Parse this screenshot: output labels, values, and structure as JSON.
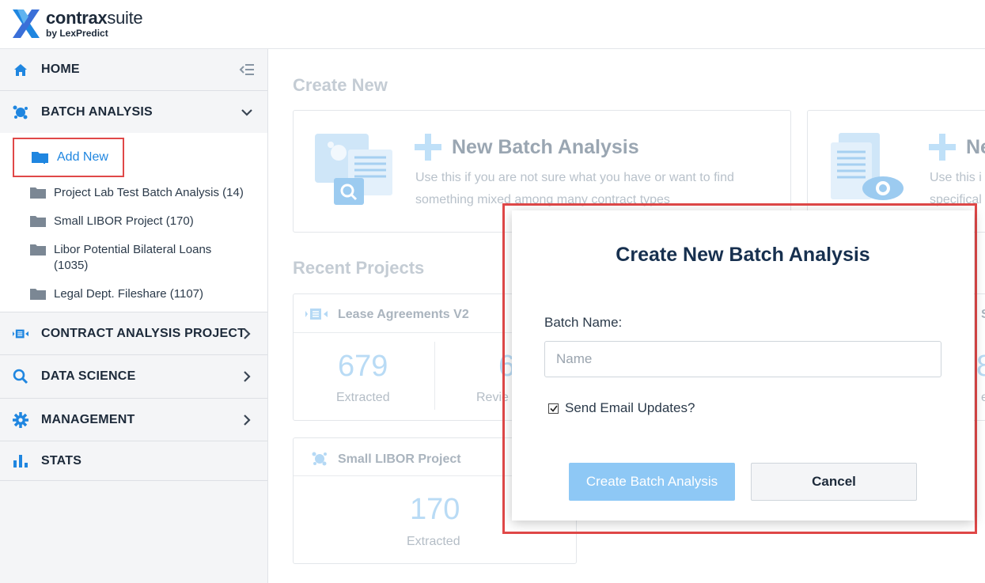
{
  "app": {
    "brand_bold": "contrax",
    "brand_light": "suite",
    "by_line": "by LexPredict"
  },
  "sidebar": {
    "home": "HOME",
    "batch_analysis": "BATCH ANALYSIS",
    "add_new": "Add New",
    "projects": [
      {
        "name": "Project Lab Test Batch Analysis (14)"
      },
      {
        "name": "Small LIBOR Project (170)"
      },
      {
        "name": "Libor Potential Bilateral Loans (1035)"
      },
      {
        "name": "Legal Dept. Fileshare (1107)"
      }
    ],
    "contract_analysis": "CONTRACT ANALYSIS PROJECT",
    "data_science": "DATA SCIENCE",
    "management": "MANAGEMENT",
    "stats": "STATS"
  },
  "main": {
    "create_new_title": "Create New",
    "cards": [
      {
        "title": "New Batch Analysis",
        "desc": "Use this if you are not sure what you have or want to find something mixed among many contract types"
      },
      {
        "title": "Ne",
        "desc": "Use this i specifical"
      }
    ],
    "recent_projects_title": "Recent Projects",
    "recent": [
      {
        "name": "Lease Agreements V2",
        "stat1_value": "679",
        "stat1_label": "Extracted",
        "stat2_value": "6",
        "stat2_label": "Revie"
      },
      {
        "name": "Small LIBOR Project",
        "stat1_value": "170",
        "stat1_label": "Extracted"
      }
    ],
    "right_partial": {
      "letter": "S",
      "num": "8",
      "label": "e"
    }
  },
  "modal": {
    "title": "Create New Batch Analysis",
    "field_label": "Batch Name:",
    "input_placeholder": "Name",
    "input_value": "",
    "checkbox_label": "Send Email Updates?",
    "checkbox_checked": true,
    "primary_button": "Create Batch Analysis",
    "cancel_button": "Cancel"
  },
  "colors": {
    "accent": "#1f86e0",
    "highlight_outline": "#e04848",
    "primary_button": "#8ec8f5"
  }
}
